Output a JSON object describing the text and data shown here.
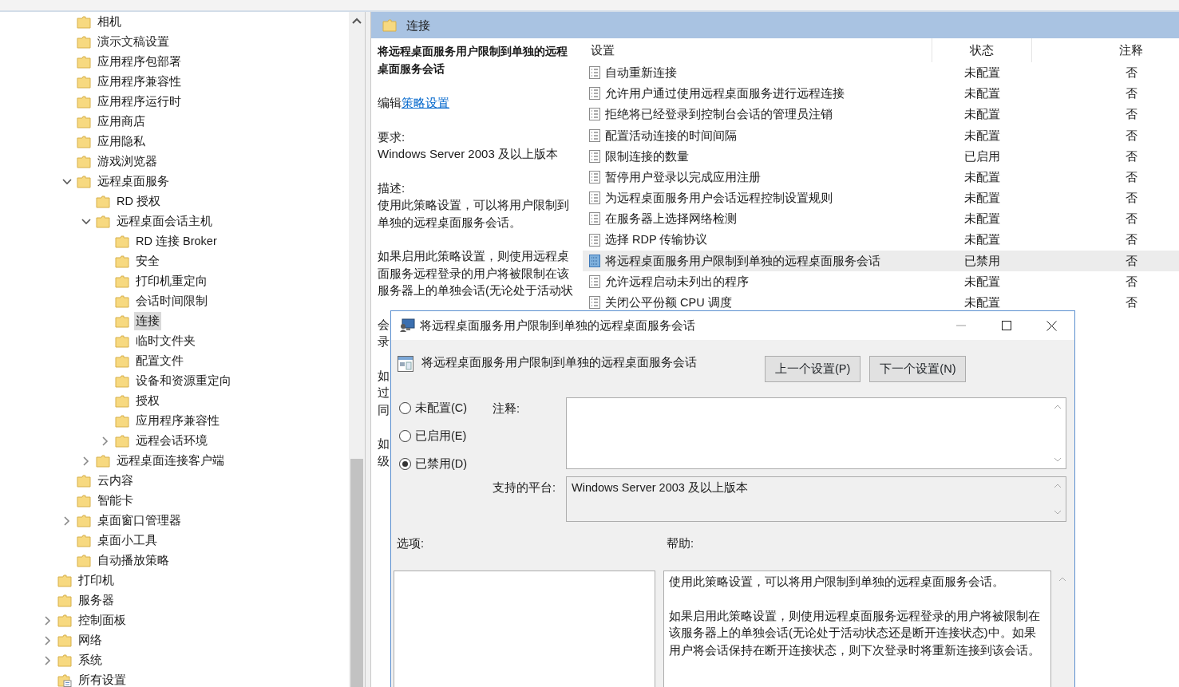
{
  "tree": [
    {
      "children": [
        {
          "label": "相机",
          "kind": "folder",
          "selected": false
        },
        {
          "label": "演示文稿设置",
          "kind": "folder",
          "selected": false
        },
        {
          "label": "应用程序包部署",
          "kind": "folder",
          "selected": false
        },
        {
          "label": "应用程序兼容性",
          "kind": "folder",
          "selected": false
        },
        {
          "label": "应用程序运行时",
          "kind": "folder",
          "selected": false
        },
        {
          "label": "应用商店",
          "kind": "folder",
          "selected": false
        },
        {
          "label": "应用隐私",
          "kind": "folder",
          "selected": false
        },
        {
          "label": "游戏浏览器",
          "kind": "folder",
          "selected": false
        },
        {
          "label": "远程桌面服务",
          "kind": "folder",
          "selected": false,
          "expanded": true,
          "children": [
            {
              "label": "RD 授权",
              "kind": "folder",
              "selected": false
            },
            {
              "label": "远程桌面会话主机",
              "kind": "folder",
              "selected": false,
              "expanded": true,
              "children": [
                {
                  "label": "RD 连接 Broker",
                  "kind": "folder",
                  "selected": false
                },
                {
                  "label": "安全",
                  "kind": "folder",
                  "selected": false
                },
                {
                  "label": "打印机重定向",
                  "kind": "folder",
                  "selected": false
                },
                {
                  "label": "会话时间限制",
                  "kind": "folder",
                  "selected": false
                },
                {
                  "label": "连接",
                  "kind": "folder",
                  "selected": true
                },
                {
                  "label": "临时文件夹",
                  "kind": "folder",
                  "selected": false
                },
                {
                  "label": "配置文件",
                  "kind": "folder",
                  "selected": false
                },
                {
                  "label": "设备和资源重定向",
                  "kind": "folder",
                  "selected": false
                },
                {
                  "label": "授权",
                  "kind": "folder",
                  "selected": false
                },
                {
                  "label": "应用程序兼容性",
                  "kind": "folder",
                  "selected": false
                },
                {
                  "label": "远程会话环境",
                  "kind": "folder",
                  "selected": false,
                  "expanded": false
                }
              ]
            },
            {
              "label": "远程桌面连接客户端",
              "kind": "folder",
              "selected": false,
              "expanded": false
            }
          ]
        },
        {
          "label": "云内容",
          "kind": "folder",
          "selected": false
        },
        {
          "label": "智能卡",
          "kind": "folder",
          "selected": false
        },
        {
          "label": "桌面窗口管理器",
          "kind": "folder",
          "selected": false,
          "expanded": false
        },
        {
          "label": "桌面小工具",
          "kind": "folder",
          "selected": false
        },
        {
          "label": "自动播放策略",
          "kind": "folder",
          "selected": false
        }
      ]
    },
    {
      "label": "打印机",
      "kind": "folder",
      "selected": false
    },
    {
      "label": "服务器",
      "kind": "folder",
      "selected": false
    },
    {
      "label": "控制面板",
      "kind": "folder",
      "selected": false,
      "expanded": false
    },
    {
      "label": "网络",
      "kind": "folder",
      "selected": false,
      "expanded": false
    },
    {
      "label": "系统",
      "kind": "folder",
      "selected": false,
      "expanded": false
    },
    {
      "label": "所有设置",
      "kind": "settings",
      "selected": false
    }
  ],
  "folder_header": {
    "title": "连接"
  },
  "details": {
    "title": "将远程桌面服务用户限制到单独的远程桌面服务会话",
    "edit_prefix": "编辑",
    "edit_link": "策略设置",
    "requirement_label": "要求:",
    "requirement": "Windows Server 2003 及以上版本",
    "description_label": "描述:",
    "paragraphs": [
      "使用此策略设置，可以将用户限制到单独的远程桌面服务会话。",
      "如果启用此策略设置，则使用远程桌面服务远程登录的用户将被限制在该服务器上的单独会话(无论处于活动状"
    ],
    "covered_fragments": [
      [
        "会",
        "录"
      ],
      [
        "如",
        "过",
        "同"
      ],
      [
        "如",
        "级"
      ]
    ]
  },
  "settings_table": {
    "columns": [
      "设置",
      "状态",
      "注释"
    ],
    "rows": [
      {
        "name": "自动重新连接",
        "state": "未配置",
        "comment": "否",
        "selected": false
      },
      {
        "name": "允许用户通过使用远程桌面服务进行远程连接",
        "state": "未配置",
        "comment": "否",
        "selected": false
      },
      {
        "name": "拒绝将已经登录到控制台会话的管理员注销",
        "state": "未配置",
        "comment": "否",
        "selected": false
      },
      {
        "name": "配置活动连接的时间间隔",
        "state": "未配置",
        "comment": "否",
        "selected": false
      },
      {
        "name": "限制连接的数量",
        "state": "已启用",
        "comment": "否",
        "selected": false
      },
      {
        "name": "暂停用户登录以完成应用注册",
        "state": "未配置",
        "comment": "否",
        "selected": false
      },
      {
        "name": "为远程桌面服务用户会话远程控制设置规则",
        "state": "未配置",
        "comment": "否",
        "selected": false
      },
      {
        "name": "在服务器上选择网络检测",
        "state": "未配置",
        "comment": "否",
        "selected": false
      },
      {
        "name": "选择 RDP 传输协议",
        "state": "未配置",
        "comment": "否",
        "selected": false
      },
      {
        "name": "将远程桌面服务用户限制到单独的远程桌面服务会话",
        "state": "已禁用",
        "comment": "否",
        "selected": true
      },
      {
        "name": "允许远程启动未列出的程序",
        "state": "未配置",
        "comment": "否",
        "selected": false
      },
      {
        "name": "关闭公平份额 CPU 调度",
        "state": "未配置",
        "comment": "否",
        "selected": false
      }
    ]
  },
  "dialog": {
    "title": "将远程桌面服务用户限制到单独的远程桌面服务会话",
    "heading": "将远程桌面服务用户限制到单独的远程桌面服务会话",
    "buttons": [
      "上一个设置(P)",
      "下一个设置(N)"
    ],
    "options": [
      {
        "label": "未配置(C)",
        "selected": false
      },
      {
        "label": "已启用(E)",
        "selected": false
      },
      {
        "label": "已禁用(D)",
        "selected": true
      }
    ],
    "comment_label": "注释:",
    "platform_label": "支持的平台:",
    "platform": "Windows Server 2003 及以上版本",
    "options_label": "选项:",
    "help_label": "帮助:",
    "help_paragraphs": [
      "使用此策略设置，可以将用户限制到单独的远程桌面服务会话。",
      "如果启用此策略设置，则使用远程桌面服务远程登录的用户将被限制在该服务器上的单独会话(无论处于活动状态还是断开连接状态)中。如果用户将会话保持在断开连接状态，则下次登录时将重新连接到该会话。"
    ]
  }
}
